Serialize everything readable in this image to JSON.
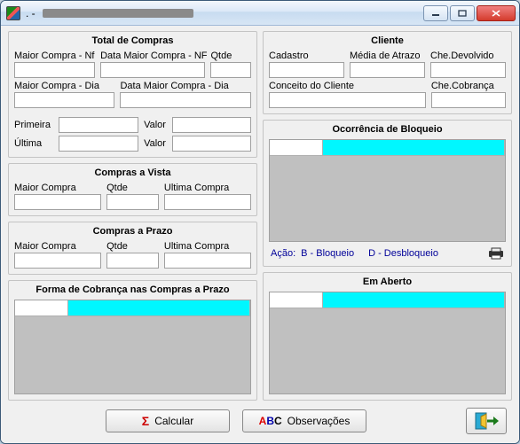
{
  "window": {
    "title_prefix": ". -"
  },
  "totals": {
    "title": "Total de Compras",
    "maior_compra_nf_label": "Maior Compra - Nf",
    "maior_compra_nf": "",
    "data_maior_compra_nf_label": "Data Maior Compra - NF",
    "data_maior_compra_nf": "",
    "qtde_nf_label": "Qtde",
    "qtde_nf": "",
    "maior_compra_dia_label": "Maior Compra - Dia",
    "maior_compra_dia": "",
    "data_maior_compra_dia_label": "Data Maior Compra - Dia",
    "data_maior_compra_dia": "",
    "primeira_label": "Primeira",
    "primeira": "",
    "primeira_valor_label": "Valor",
    "primeira_valor": "",
    "ultima_label": "Última",
    "ultima": "",
    "ultima_valor_label": "Valor",
    "ultima_valor": ""
  },
  "vista": {
    "title": "Compras a Vista",
    "maior_compra_label": "Maior Compra",
    "maior_compra": "",
    "qtde_label": "Qtde",
    "qtde": "",
    "ultima_compra_label": "Ultima Compra",
    "ultima_compra": ""
  },
  "prazo": {
    "title": "Compras a Prazo",
    "maior_compra_label": "Maior Compra",
    "maior_compra": "",
    "qtde_label": "Qtde",
    "qtde": "",
    "ultima_compra_label": "Ultima Compra",
    "ultima_compra": ""
  },
  "cobranca": {
    "title": "Forma de Cobrança nas Compras a Prazo"
  },
  "cliente": {
    "title": "Cliente",
    "cadastro_label": "Cadastro",
    "cadastro": "",
    "media_atrazo_label": "Média de Atrazo",
    "media_atrazo": "",
    "che_devolvido_label": "Che.Devolvido",
    "che_devolvido": "",
    "conceito_label": "Conceito do Cliente",
    "conceito": "",
    "che_cobranca_label": "Che.Cobrança",
    "che_cobranca": ""
  },
  "bloqueio": {
    "title": "Ocorrência de Bloqueio",
    "legend_acao": "Ação:",
    "legend_b": "B - Bloqueio",
    "legend_d": "D - Desbloqueio"
  },
  "aberto": {
    "title": "Em Aberto"
  },
  "footer": {
    "calcular": "Calcular",
    "observacoes": "Observações"
  }
}
